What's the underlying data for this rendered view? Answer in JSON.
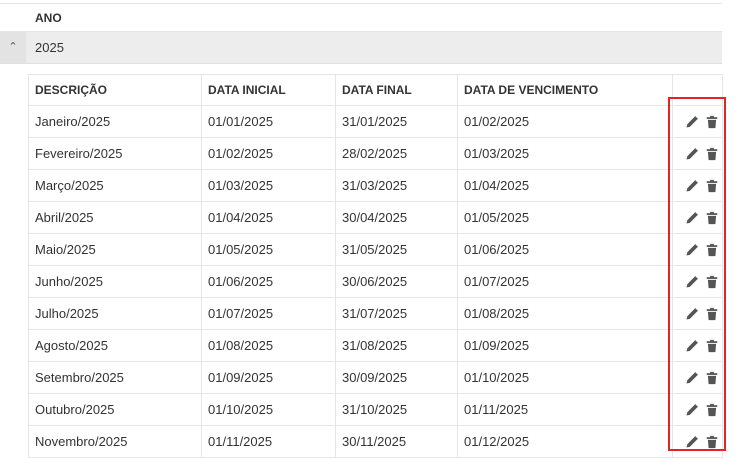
{
  "group_header": {
    "label": "ANO"
  },
  "group_row": {
    "value": "2025",
    "toggle_icon": "chevron-up-icon"
  },
  "columns": [
    "DESCRIÇÃO",
    "DATA INICIAL",
    "DATA FINAL",
    "DATA DE VENCIMENTO",
    ""
  ],
  "rows": [
    {
      "descricao": "Janeiro/2025",
      "inicial": "01/01/2025",
      "final": "31/01/2025",
      "vencimento": "01/02/2025"
    },
    {
      "descricao": "Fevereiro/2025",
      "inicial": "01/02/2025",
      "final": "28/02/2025",
      "vencimento": "01/03/2025"
    },
    {
      "descricao": "Março/2025",
      "inicial": "01/03/2025",
      "final": "31/03/2025",
      "vencimento": "01/04/2025"
    },
    {
      "descricao": "Abril/2025",
      "inicial": "01/04/2025",
      "final": "30/04/2025",
      "vencimento": "01/05/2025"
    },
    {
      "descricao": "Maio/2025",
      "inicial": "01/05/2025",
      "final": "31/05/2025",
      "vencimento": "01/06/2025"
    },
    {
      "descricao": "Junho/2025",
      "inicial": "01/06/2025",
      "final": "30/06/2025",
      "vencimento": "01/07/2025"
    },
    {
      "descricao": "Julho/2025",
      "inicial": "01/07/2025",
      "final": "31/07/2025",
      "vencimento": "01/08/2025"
    },
    {
      "descricao": "Agosto/2025",
      "inicial": "01/08/2025",
      "final": "31/08/2025",
      "vencimento": "01/09/2025"
    },
    {
      "descricao": "Setembro/2025",
      "inicial": "01/09/2025",
      "final": "30/09/2025",
      "vencimento": "01/10/2025"
    },
    {
      "descricao": "Outubro/2025",
      "inicial": "01/10/2025",
      "final": "31/10/2025",
      "vencimento": "01/11/2025"
    },
    {
      "descricao": "Novembro/2025",
      "inicial": "01/11/2025",
      "final": "30/11/2025",
      "vencimento": "01/12/2025"
    }
  ],
  "row_actions": [
    "pencil-icon",
    "trash-icon"
  ],
  "colors": {
    "highlight": "#e32424",
    "group_row_bg": "#ededed",
    "icon": "#555555"
  }
}
